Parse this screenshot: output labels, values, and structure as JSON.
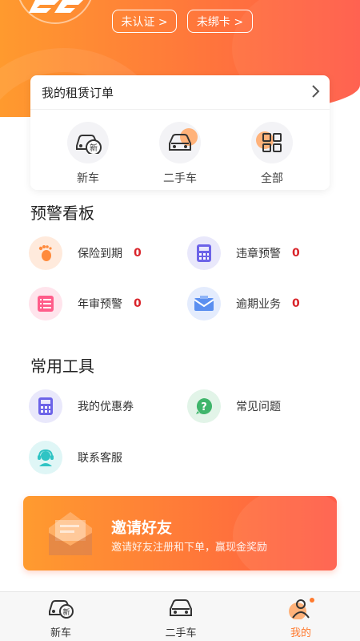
{
  "header": {
    "verify_label": "未认证 >",
    "bindcard_label": "未绑卡 >"
  },
  "orders": {
    "title": "我的租赁订单",
    "items": [
      {
        "label": "新车",
        "icon": "new-car-icon"
      },
      {
        "label": "二手车",
        "icon": "used-car-icon"
      },
      {
        "label": "全部",
        "icon": "grid-icon"
      }
    ]
  },
  "warning_board": {
    "title": "预警看板",
    "items": [
      {
        "label": "保险到期",
        "count": "0",
        "icon": "footprint-icon",
        "color": "#ff8a3c"
      },
      {
        "label": "违章预警",
        "count": "0",
        "icon": "calculator-icon",
        "color": "#6c63e8"
      },
      {
        "label": "年审预警",
        "count": "0",
        "icon": "checklist-icon",
        "color": "#ff5c8a"
      },
      {
        "label": "逾期业务",
        "count": "0",
        "icon": "envelope-icon",
        "color": "#5b8ff0"
      }
    ]
  },
  "tools": {
    "title": "常用工具",
    "items": [
      {
        "label": "我的优惠券",
        "icon": "coupon-icon",
        "color": "#6c63e8"
      },
      {
        "label": "常见问题",
        "icon": "question-icon",
        "color": "#3fb56b"
      },
      {
        "label": "联系客服",
        "icon": "support-icon",
        "color": "#2fc4c4"
      }
    ]
  },
  "invite": {
    "title": "邀请好友",
    "subtitle": "邀请好友注册和下单，赢现金奖励"
  },
  "tabbar": {
    "items": [
      {
        "label": "新车",
        "active": false
      },
      {
        "label": "二手车",
        "active": false
      },
      {
        "label": "我的",
        "active": true
      }
    ]
  },
  "colors": {
    "brand_orange": "#ff7a2e",
    "alert_red": "#d9242a"
  }
}
